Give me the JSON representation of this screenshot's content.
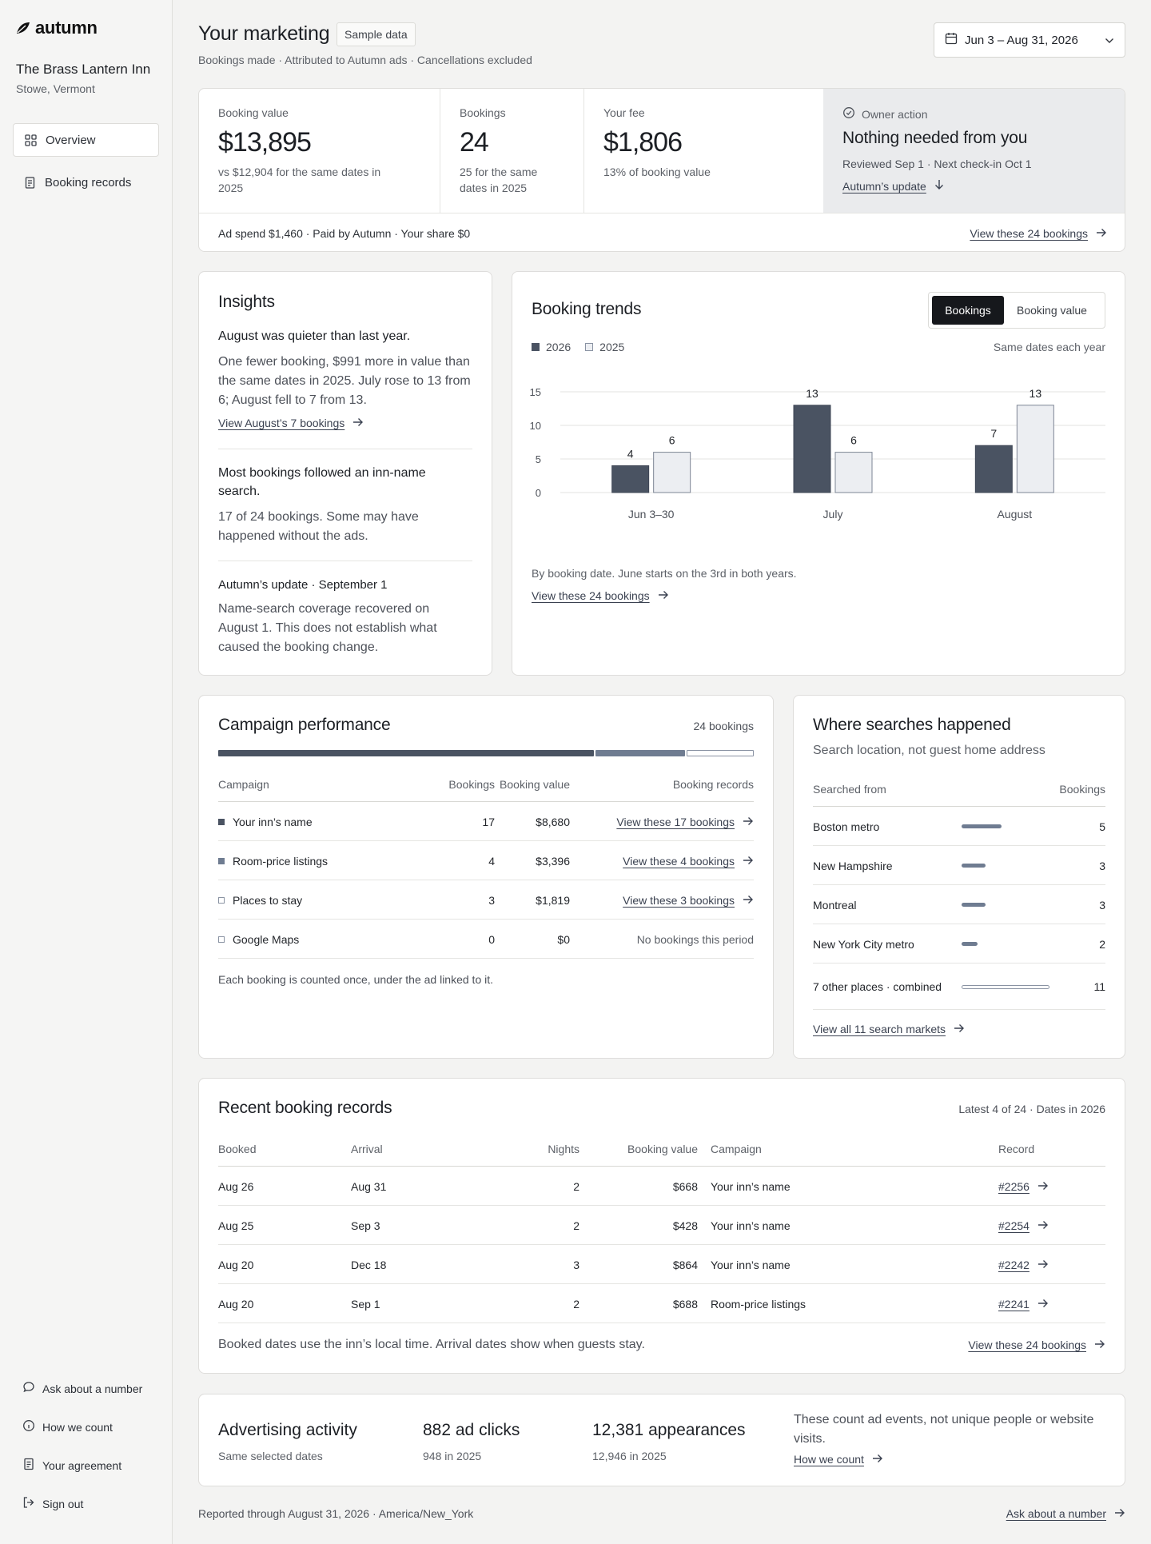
{
  "app": {
    "logo_text": "autumn"
  },
  "sidebar": {
    "inn_name": "The Brass Lantern Inn",
    "inn_location": "Stowe, Vermont",
    "nav": [
      {
        "label": "Overview",
        "icon": "grid-icon",
        "active": true
      },
      {
        "label": "Booking records",
        "icon": "document-icon",
        "active": false
      }
    ],
    "footer": [
      {
        "label": "Ask about a number",
        "icon": "chat-bubble-icon"
      },
      {
        "label": "How we count",
        "icon": "info-icon"
      },
      {
        "label": "Your agreement",
        "icon": "document-icon"
      },
      {
        "label": "Sign out",
        "icon": "sign-out-icon"
      }
    ]
  },
  "header": {
    "title": "Your marketing",
    "badge": "Sample data",
    "subtitle": "Bookings made · Attributed to Autumn ads · Cancellations excluded",
    "date_range": "Jun 3 – Aug 31, 2026"
  },
  "kpis": [
    {
      "label": "Booking value",
      "value": "$13,895",
      "note": "vs $12,904 for the same dates in 2025"
    },
    {
      "label": "Bookings",
      "value": "24",
      "note": "25 for the same dates in 2025"
    },
    {
      "label": "Your fee",
      "value": "$1,806",
      "note": "13% of booking value"
    }
  ],
  "owner_action": {
    "label": "Owner action",
    "title": "Nothing needed from you",
    "note": "Reviewed Sep 1 · Next check-in Oct 1",
    "link": "Autumn’s update"
  },
  "kpi_footer": {
    "text": "Ad spend $1,460 · Paid by Autumn · Your share $0",
    "link": "View these 24 bookings"
  },
  "insights": {
    "title": "Insights",
    "items": [
      {
        "heading": "August was quieter than last year.",
        "body": "One fewer booking, $991 more in value than the same dates in 2025. July rose to 13 from 6; August fell to 7 from 13.",
        "link": "View August’s 7 bookings"
      },
      {
        "heading": "Most bookings followed an inn-name search.",
        "body": "17 of 24 bookings. Some may have happened without the ads."
      },
      {
        "heading": "Autumn’s update · September 1",
        "body": "Name-search coverage recovered on August 1. This does not establish what caused the booking change."
      }
    ]
  },
  "trends": {
    "title": "Booking trends",
    "toggle": [
      "Bookings",
      "Booking value"
    ],
    "compare_note": "Same dates each year",
    "footnote": "By booking date. June starts on the 3rd in both years.",
    "link": "View these 24 bookings"
  },
  "chart_data": {
    "type": "bar",
    "categories": [
      "Jun 3–30",
      "July",
      "August"
    ],
    "series": [
      {
        "name": "2026",
        "values": [
          4,
          13,
          7
        ],
        "color": "#4a5362"
      },
      {
        "name": "2025",
        "values": [
          6,
          6,
          13
        ],
        "color": "#eceef2"
      }
    ],
    "yticks": [
      0,
      5,
      10,
      15
    ],
    "ylim": [
      0,
      15
    ],
    "grid": true,
    "legend": "top-left"
  },
  "campaigns": {
    "title": "Campaign performance",
    "count": "24 bookings",
    "share_bar": [
      17,
      4,
      3
    ],
    "headers": [
      "Campaign",
      "Bookings",
      "Booking value",
      "Booking records"
    ],
    "rows": [
      {
        "name": "Your inn’s name",
        "bookings": "17",
        "value": "$8,680",
        "record": "View these 17 bookings",
        "link": true,
        "marker": "#4a5362",
        "filled": true
      },
      {
        "name": "Room-price listings",
        "bookings": "4",
        "value": "$3,396",
        "record": "View these 4 bookings",
        "link": true,
        "marker": "#6f7c91",
        "filled": true
      },
      {
        "name": "Places to stay",
        "bookings": "3",
        "value": "$1,819",
        "record": "View these 3 bookings",
        "link": true,
        "marker": "#8a93a3",
        "filled": false
      },
      {
        "name": "Google Maps",
        "bookings": "0",
        "value": "$0",
        "record": "No bookings this period",
        "link": false,
        "marker": "#8a93a3",
        "filled": false
      }
    ],
    "footnote": "Each booking is counted once, under the ad linked to it."
  },
  "searches": {
    "title": "Where searches happened",
    "subtitle": "Search location, not guest home address",
    "headers": [
      "Searched from",
      "Bookings"
    ],
    "rows": [
      {
        "place": "Boston metro",
        "bookings": "5",
        "share": 5
      },
      {
        "place": "New Hampshire",
        "bookings": "3",
        "share": 3
      },
      {
        "place": "Montreal",
        "bookings": "3",
        "share": 3
      },
      {
        "place": "New York City metro",
        "bookings": "2",
        "share": 2
      },
      {
        "place": "7 other places · combined",
        "bookings": "11",
        "share": 11
      }
    ],
    "link": "View all 11 search markets"
  },
  "records": {
    "title": "Recent booking records",
    "meta": "Latest 4 of 24 · Dates in 2026",
    "headers": [
      "Booked",
      "Arrival",
      "Nights",
      "Booking value",
      "Campaign",
      "Record"
    ],
    "rows": [
      {
        "booked": "Aug 26",
        "arrival": "Aug 31",
        "nights": "2",
        "value": "$668",
        "campaign": "Your inn’s name",
        "record": "#2256"
      },
      {
        "booked": "Aug 25",
        "arrival": "Sep 3",
        "nights": "2",
        "value": "$428",
        "campaign": "Your inn’s name",
        "record": "#2254"
      },
      {
        "booked": "Aug 20",
        "arrival": "Dec 18",
        "nights": "3",
        "value": "$864",
        "campaign": "Your inn’s name",
        "record": "#2242"
      },
      {
        "booked": "Aug 20",
        "arrival": "Sep 1",
        "nights": "2",
        "value": "$688",
        "campaign": "Room-price listings",
        "record": "#2241"
      }
    ],
    "footnote": "Booked dates use the inn’s local time. Arrival dates show when guests stay.",
    "link": "View these 24 bookings"
  },
  "ad_activity": {
    "title": "Advertising activity",
    "subtitle": "Same selected dates",
    "clicks": "882 ad clicks",
    "clicks_prev": "948 in 2025",
    "appearances": "12,381 appearances",
    "appearances_prev": "12,946 in 2025",
    "note": "These count ad events, not unique people or website visits.",
    "link": "How we count"
  },
  "page_footer": {
    "text": "Reported through August 31, 2026 · America/New_York",
    "link": "Ask about a number"
  }
}
